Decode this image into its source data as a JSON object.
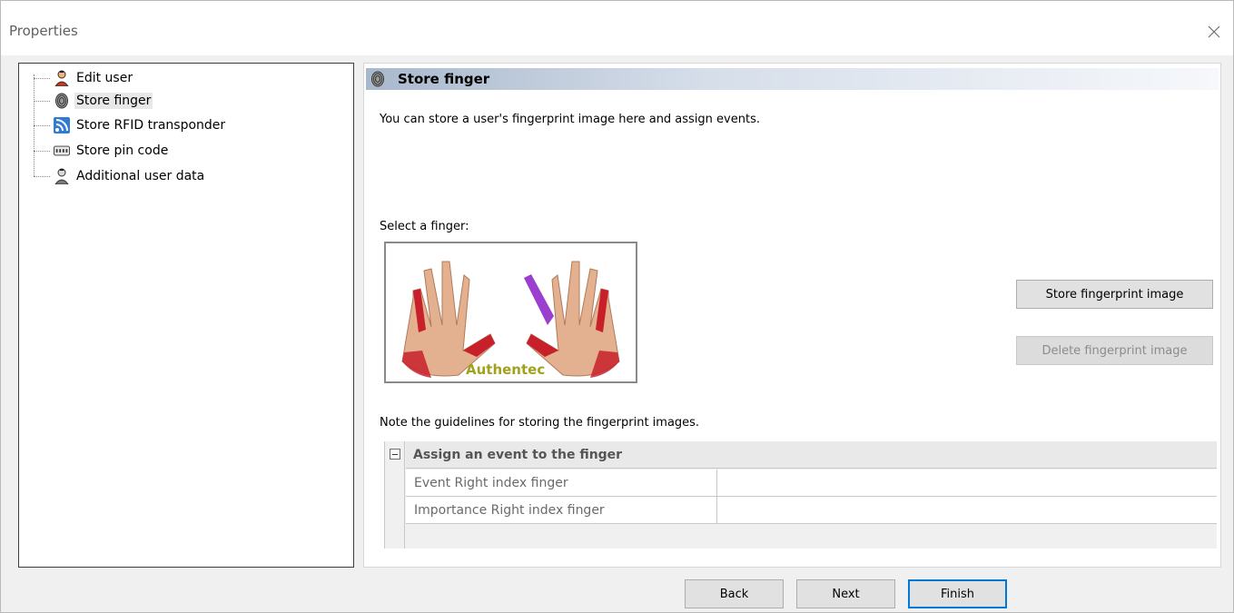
{
  "window": {
    "title": "Properties"
  },
  "tree": {
    "items": [
      {
        "label": "Edit user",
        "icon": "user-icon"
      },
      {
        "label": "Store finger",
        "icon": "fingerprint-icon",
        "selected": true
      },
      {
        "label": "Store RFID transponder",
        "icon": "rfid-icon"
      },
      {
        "label": "Store pin code",
        "icon": "keypad-icon"
      },
      {
        "label": "Additional user data",
        "icon": "user-data-icon"
      }
    ]
  },
  "content": {
    "header_title": "Store finger",
    "description": "You can store a user's fingerprint image here and assign events.",
    "select_label": "Select a finger:",
    "brand_label": "Authentec",
    "selected_finger": "Right index finger",
    "note": "Note the guidelines for storing the fingerprint images.",
    "store_button": "Store fingerprint image",
    "delete_button": "Delete fingerprint image"
  },
  "grid": {
    "category": "Assign an event to the finger",
    "rows": [
      {
        "name": "Event Right index finger",
        "value": ""
      },
      {
        "name": "Importance Right index finger",
        "value": ""
      }
    ]
  },
  "nav": {
    "back": "Back",
    "next": "Next",
    "finish": "Finish"
  },
  "colors": {
    "header_gradient_start": "#a9b9cd",
    "hand_red": "#c8202a",
    "finger_selected_purple": "#9b3fd0",
    "brand_olive": "#a0a21e",
    "default_button_border": "#0078d7"
  }
}
